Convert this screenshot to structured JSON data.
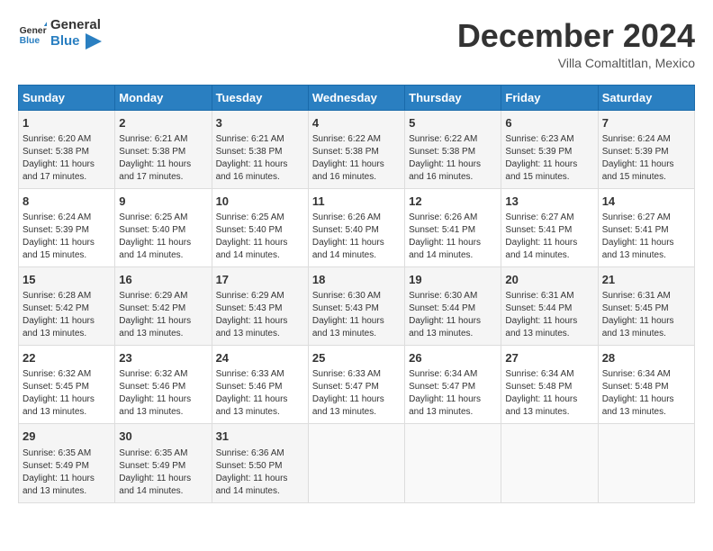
{
  "header": {
    "logo_general": "General",
    "logo_blue": "Blue",
    "month_title": "December 2024",
    "location": "Villa Comaltitlan, Mexico"
  },
  "weekdays": [
    "Sunday",
    "Monday",
    "Tuesday",
    "Wednesday",
    "Thursday",
    "Friday",
    "Saturday"
  ],
  "weeks": [
    [
      {
        "day": "1",
        "sunrise": "6:20 AM",
        "sunset": "5:38 PM",
        "daylight": "11 hours and 17 minutes."
      },
      {
        "day": "2",
        "sunrise": "6:21 AM",
        "sunset": "5:38 PM",
        "daylight": "11 hours and 17 minutes."
      },
      {
        "day": "3",
        "sunrise": "6:21 AM",
        "sunset": "5:38 PM",
        "daylight": "11 hours and 16 minutes."
      },
      {
        "day": "4",
        "sunrise": "6:22 AM",
        "sunset": "5:38 PM",
        "daylight": "11 hours and 16 minutes."
      },
      {
        "day": "5",
        "sunrise": "6:22 AM",
        "sunset": "5:38 PM",
        "daylight": "11 hours and 16 minutes."
      },
      {
        "day": "6",
        "sunrise": "6:23 AM",
        "sunset": "5:39 PM",
        "daylight": "11 hours and 15 minutes."
      },
      {
        "day": "7",
        "sunrise": "6:24 AM",
        "sunset": "5:39 PM",
        "daylight": "11 hours and 15 minutes."
      }
    ],
    [
      {
        "day": "8",
        "sunrise": "6:24 AM",
        "sunset": "5:39 PM",
        "daylight": "11 hours and 15 minutes."
      },
      {
        "day": "9",
        "sunrise": "6:25 AM",
        "sunset": "5:40 PM",
        "daylight": "11 hours and 14 minutes."
      },
      {
        "day": "10",
        "sunrise": "6:25 AM",
        "sunset": "5:40 PM",
        "daylight": "11 hours and 14 minutes."
      },
      {
        "day": "11",
        "sunrise": "6:26 AM",
        "sunset": "5:40 PM",
        "daylight": "11 hours and 14 minutes."
      },
      {
        "day": "12",
        "sunrise": "6:26 AM",
        "sunset": "5:41 PM",
        "daylight": "11 hours and 14 minutes."
      },
      {
        "day": "13",
        "sunrise": "6:27 AM",
        "sunset": "5:41 PM",
        "daylight": "11 hours and 14 minutes."
      },
      {
        "day": "14",
        "sunrise": "6:27 AM",
        "sunset": "5:41 PM",
        "daylight": "11 hours and 13 minutes."
      }
    ],
    [
      {
        "day": "15",
        "sunrise": "6:28 AM",
        "sunset": "5:42 PM",
        "daylight": "11 hours and 13 minutes."
      },
      {
        "day": "16",
        "sunrise": "6:29 AM",
        "sunset": "5:42 PM",
        "daylight": "11 hours and 13 minutes."
      },
      {
        "day": "17",
        "sunrise": "6:29 AM",
        "sunset": "5:43 PM",
        "daylight": "11 hours and 13 minutes."
      },
      {
        "day": "18",
        "sunrise": "6:30 AM",
        "sunset": "5:43 PM",
        "daylight": "11 hours and 13 minutes."
      },
      {
        "day": "19",
        "sunrise": "6:30 AM",
        "sunset": "5:44 PM",
        "daylight": "11 hours and 13 minutes."
      },
      {
        "day": "20",
        "sunrise": "6:31 AM",
        "sunset": "5:44 PM",
        "daylight": "11 hours and 13 minutes."
      },
      {
        "day": "21",
        "sunrise": "6:31 AM",
        "sunset": "5:45 PM",
        "daylight": "11 hours and 13 minutes."
      }
    ],
    [
      {
        "day": "22",
        "sunrise": "6:32 AM",
        "sunset": "5:45 PM",
        "daylight": "11 hours and 13 minutes."
      },
      {
        "day": "23",
        "sunrise": "6:32 AM",
        "sunset": "5:46 PM",
        "daylight": "11 hours and 13 minutes."
      },
      {
        "day": "24",
        "sunrise": "6:33 AM",
        "sunset": "5:46 PM",
        "daylight": "11 hours and 13 minutes."
      },
      {
        "day": "25",
        "sunrise": "6:33 AM",
        "sunset": "5:47 PM",
        "daylight": "11 hours and 13 minutes."
      },
      {
        "day": "26",
        "sunrise": "6:34 AM",
        "sunset": "5:47 PM",
        "daylight": "11 hours and 13 minutes."
      },
      {
        "day": "27",
        "sunrise": "6:34 AM",
        "sunset": "5:48 PM",
        "daylight": "11 hours and 13 minutes."
      },
      {
        "day": "28",
        "sunrise": "6:34 AM",
        "sunset": "5:48 PM",
        "daylight": "11 hours and 13 minutes."
      }
    ],
    [
      {
        "day": "29",
        "sunrise": "6:35 AM",
        "sunset": "5:49 PM",
        "daylight": "11 hours and 13 minutes."
      },
      {
        "day": "30",
        "sunrise": "6:35 AM",
        "sunset": "5:49 PM",
        "daylight": "11 hours and 14 minutes."
      },
      {
        "day": "31",
        "sunrise": "6:36 AM",
        "sunset": "5:50 PM",
        "daylight": "11 hours and 14 minutes."
      },
      null,
      null,
      null,
      null
    ]
  ],
  "labels": {
    "sunrise": "Sunrise:",
    "sunset": "Sunset:",
    "daylight": "Daylight:"
  }
}
